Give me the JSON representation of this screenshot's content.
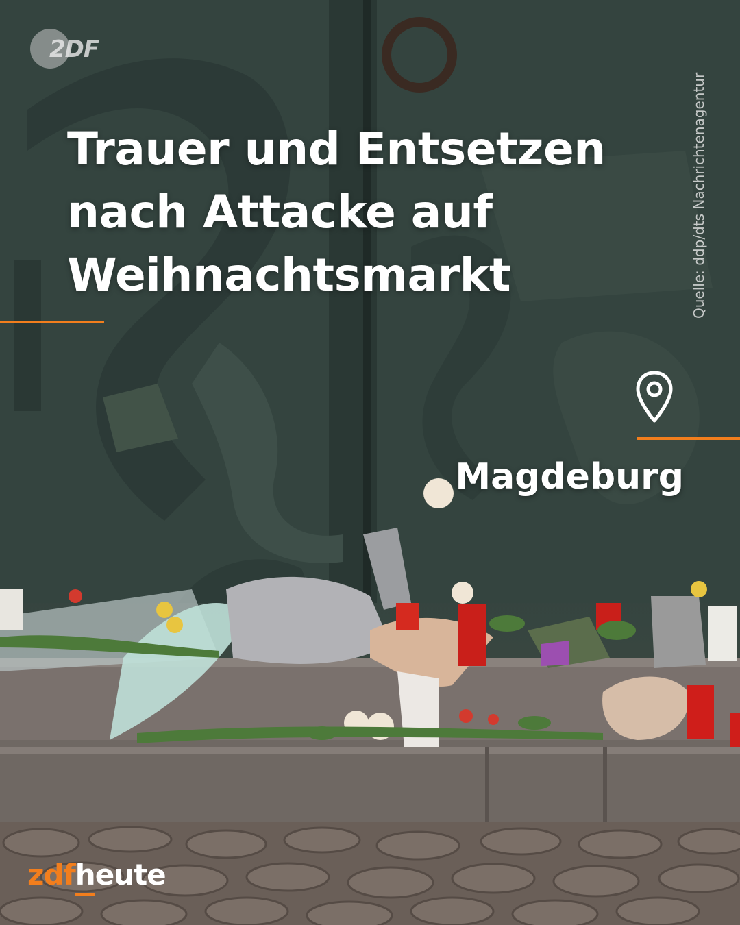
{
  "watermark": {
    "text": "2DF",
    "icon": "zdf-circle-logo"
  },
  "headline": {
    "line1": "Trauer und Entsetzen",
    "line2": "nach Attacke auf",
    "line3": "Weihnachtsmarkt"
  },
  "source": "Quelle: ddp/dts Nachrichtenagentur",
  "location": {
    "icon": "location-pin-icon",
    "name": "Magdeburg"
  },
  "logo": {
    "part1": "zdf",
    "part2": "heute"
  },
  "colors": {
    "accent": "#f27e1d",
    "text": "#ffffff"
  }
}
